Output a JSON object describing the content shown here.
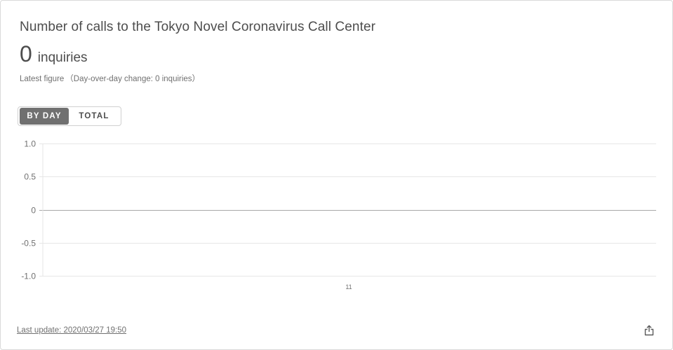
{
  "card": {
    "title": "Number of calls to the Tokyo Novel Coronavirus Call Center",
    "big_number": "0",
    "big_unit": "inquiries",
    "latest_label": "Latest figure",
    "change_text": "（Day-over-day change: 0 inquiries）",
    "last_update": "Last update: 2020/03/27 19:50"
  },
  "toggle": {
    "by_day": "BY DAY",
    "total": "TOTAL",
    "selected": "BY DAY"
  },
  "icons": {
    "share": "share-icon"
  },
  "colors": {
    "active_toggle": "#707070",
    "text": "#4d4d4d",
    "grid": "#e6e6e6",
    "zero_line": "#a8a8a8"
  },
  "chart_data": {
    "type": "bar",
    "title": "",
    "xlabel": "",
    "ylabel": "",
    "categories": [
      "11"
    ],
    "values": [
      0
    ],
    "ylim": [
      -1.0,
      1.0
    ],
    "y_ticks": [
      "1.0",
      "0.5",
      "0",
      "-0.5",
      "-1.0"
    ],
    "y_tick_values": [
      1.0,
      0.5,
      0,
      -0.5,
      -1.0
    ],
    "grid": true,
    "legend": "none"
  }
}
